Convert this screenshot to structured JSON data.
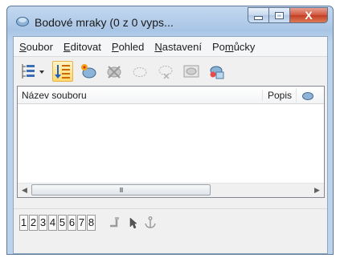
{
  "window": {
    "title": "Bodové mraky (0 z 0 vyps...",
    "close_glyph": "X"
  },
  "menu": [
    {
      "label": "Soubor",
      "hotkey": "S",
      "rest": "oubor"
    },
    {
      "label": "Editovat",
      "hotkey": "E",
      "rest": "ditovat"
    },
    {
      "label": "Pohled",
      "hotkey": "P",
      "rest": "ohled"
    },
    {
      "label": "Nastavení",
      "hotkey": "N",
      "rest": "astavení"
    },
    {
      "label": "Pomůcky",
      "pre": "Po",
      "hotkey": "m",
      "rest": "ůcky"
    }
  ],
  "list": {
    "columns": {
      "name": "Název souboru",
      "description": "Popis"
    }
  },
  "scrollbar": {
    "grip": "III"
  },
  "bottom": {
    "numbers": [
      "1",
      "2",
      "3",
      "4",
      "5",
      "6",
      "7",
      "8"
    ]
  },
  "colors": {
    "accent_active": "#ffd96e",
    "title_bar": "#a9c5e6",
    "close_button": "#c33e23"
  }
}
